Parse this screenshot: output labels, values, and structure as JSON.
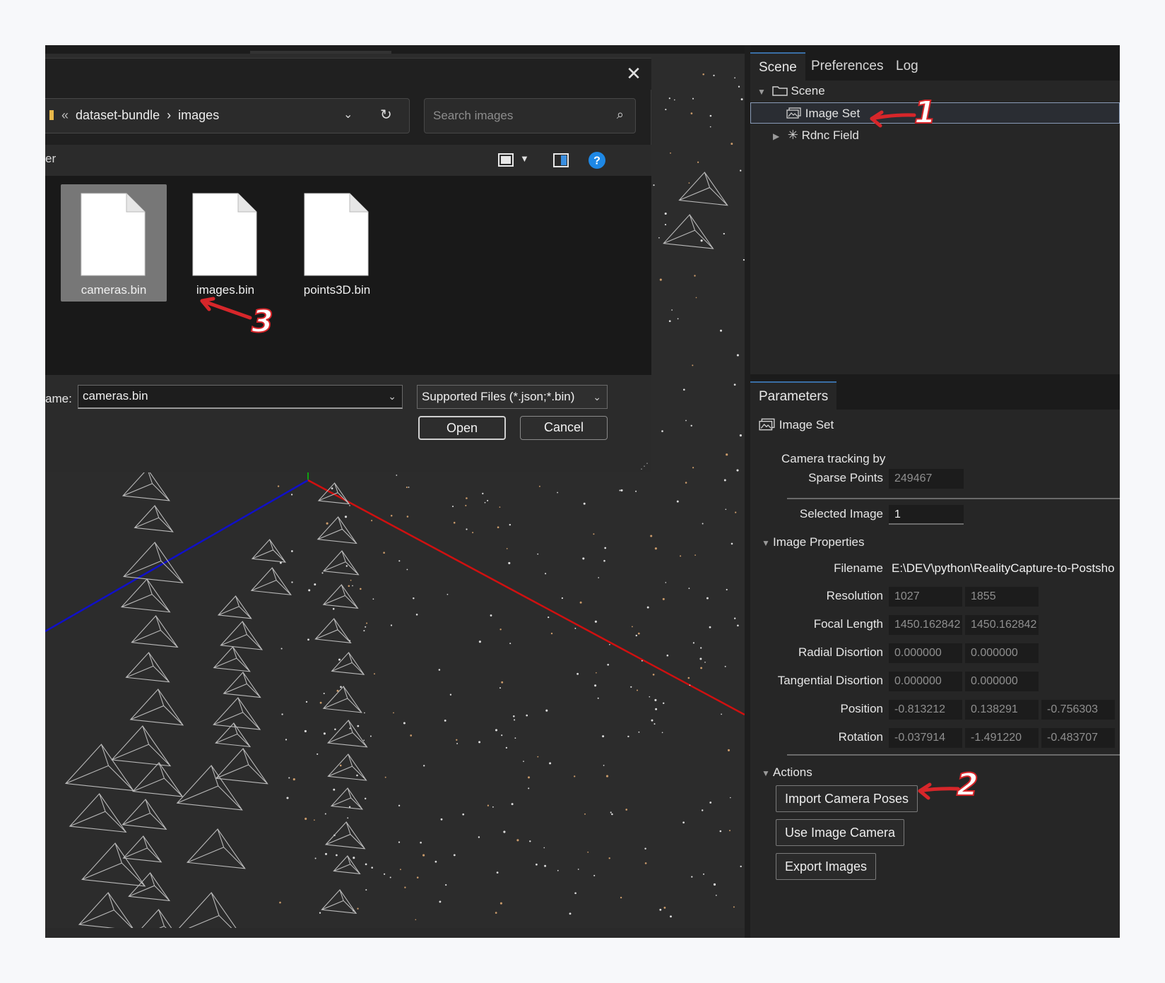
{
  "dialog": {
    "breadcrumb": [
      "dataset-bundle",
      "images"
    ],
    "breadcrumb_prefix": "«",
    "breadcrumb_sep": "›",
    "search_placeholder": "Search images",
    "left_stub_text": "er",
    "files": [
      {
        "name": "cameras.bin",
        "selected": true
      },
      {
        "name": "images.bin",
        "selected": false
      },
      {
        "name": "points3D.bin",
        "selected": false
      }
    ],
    "filename_label": "ame:",
    "filename_value": "cameras.bin",
    "filetype_value": "Supported Files (*.json;*.bin)",
    "open_label": "Open",
    "cancel_label": "Cancel",
    "close_glyph": "✕"
  },
  "scene_panel": {
    "tabs": [
      "Scene",
      "Preferences",
      "Log"
    ],
    "active_tab": "Scene",
    "tree": {
      "root": "Scene",
      "children": [
        "Image Set",
        "Rdnc Field"
      ],
      "selected": "Image Set"
    }
  },
  "parameters_panel": {
    "tab": "Parameters",
    "object_title": "Image Set",
    "camera_tracking_label": "Camera tracking by",
    "sparse_points": {
      "label": "Sparse Points",
      "value": "249467"
    },
    "selected_image": {
      "label": "Selected Image",
      "value": "1"
    },
    "image_properties": {
      "header": "Image Properties",
      "filename": {
        "label": "Filename",
        "value": "E:\\DEV\\python\\RealityCapture-to-Postsho"
      },
      "resolution": {
        "label": "Resolution",
        "values": [
          "1027",
          "1855"
        ]
      },
      "focal_length": {
        "label": "Focal Length",
        "values": [
          "1450.162842",
          "1450.162842"
        ]
      },
      "radial_distortion": {
        "label": "Radial Disortion",
        "values": [
          "0.000000",
          "0.000000"
        ]
      },
      "tangential_distortion": {
        "label": "Tangential Disortion",
        "values": [
          "0.000000",
          "0.000000"
        ]
      },
      "position": {
        "label": "Position",
        "values": [
          "-0.813212",
          "0.138291",
          "-0.756303"
        ]
      },
      "rotation": {
        "label": "Rotation",
        "values": [
          "-0.037914",
          "-1.491220",
          "-0.483707"
        ]
      }
    },
    "actions": {
      "header": "Actions",
      "buttons": [
        "Import Camera Poses",
        "Use Image Camera",
        "Export Images"
      ]
    }
  },
  "annotations": [
    "1",
    "2",
    "3"
  ],
  "colors": {
    "accent": "#3a6ea5",
    "annotation": "#d7262a",
    "axis_x": "#d01010",
    "axis_y": "#1010c8",
    "axis_z": "#10a010",
    "file_selected_bg": "#777777"
  },
  "icons": [
    "folder-icon",
    "image-set-icon",
    "radiance-field-icon",
    "search-icon",
    "refresh-icon",
    "close-icon",
    "view-icon",
    "details-pane-icon",
    "help-icon",
    "file-icon",
    "chevron-down-icon"
  ]
}
